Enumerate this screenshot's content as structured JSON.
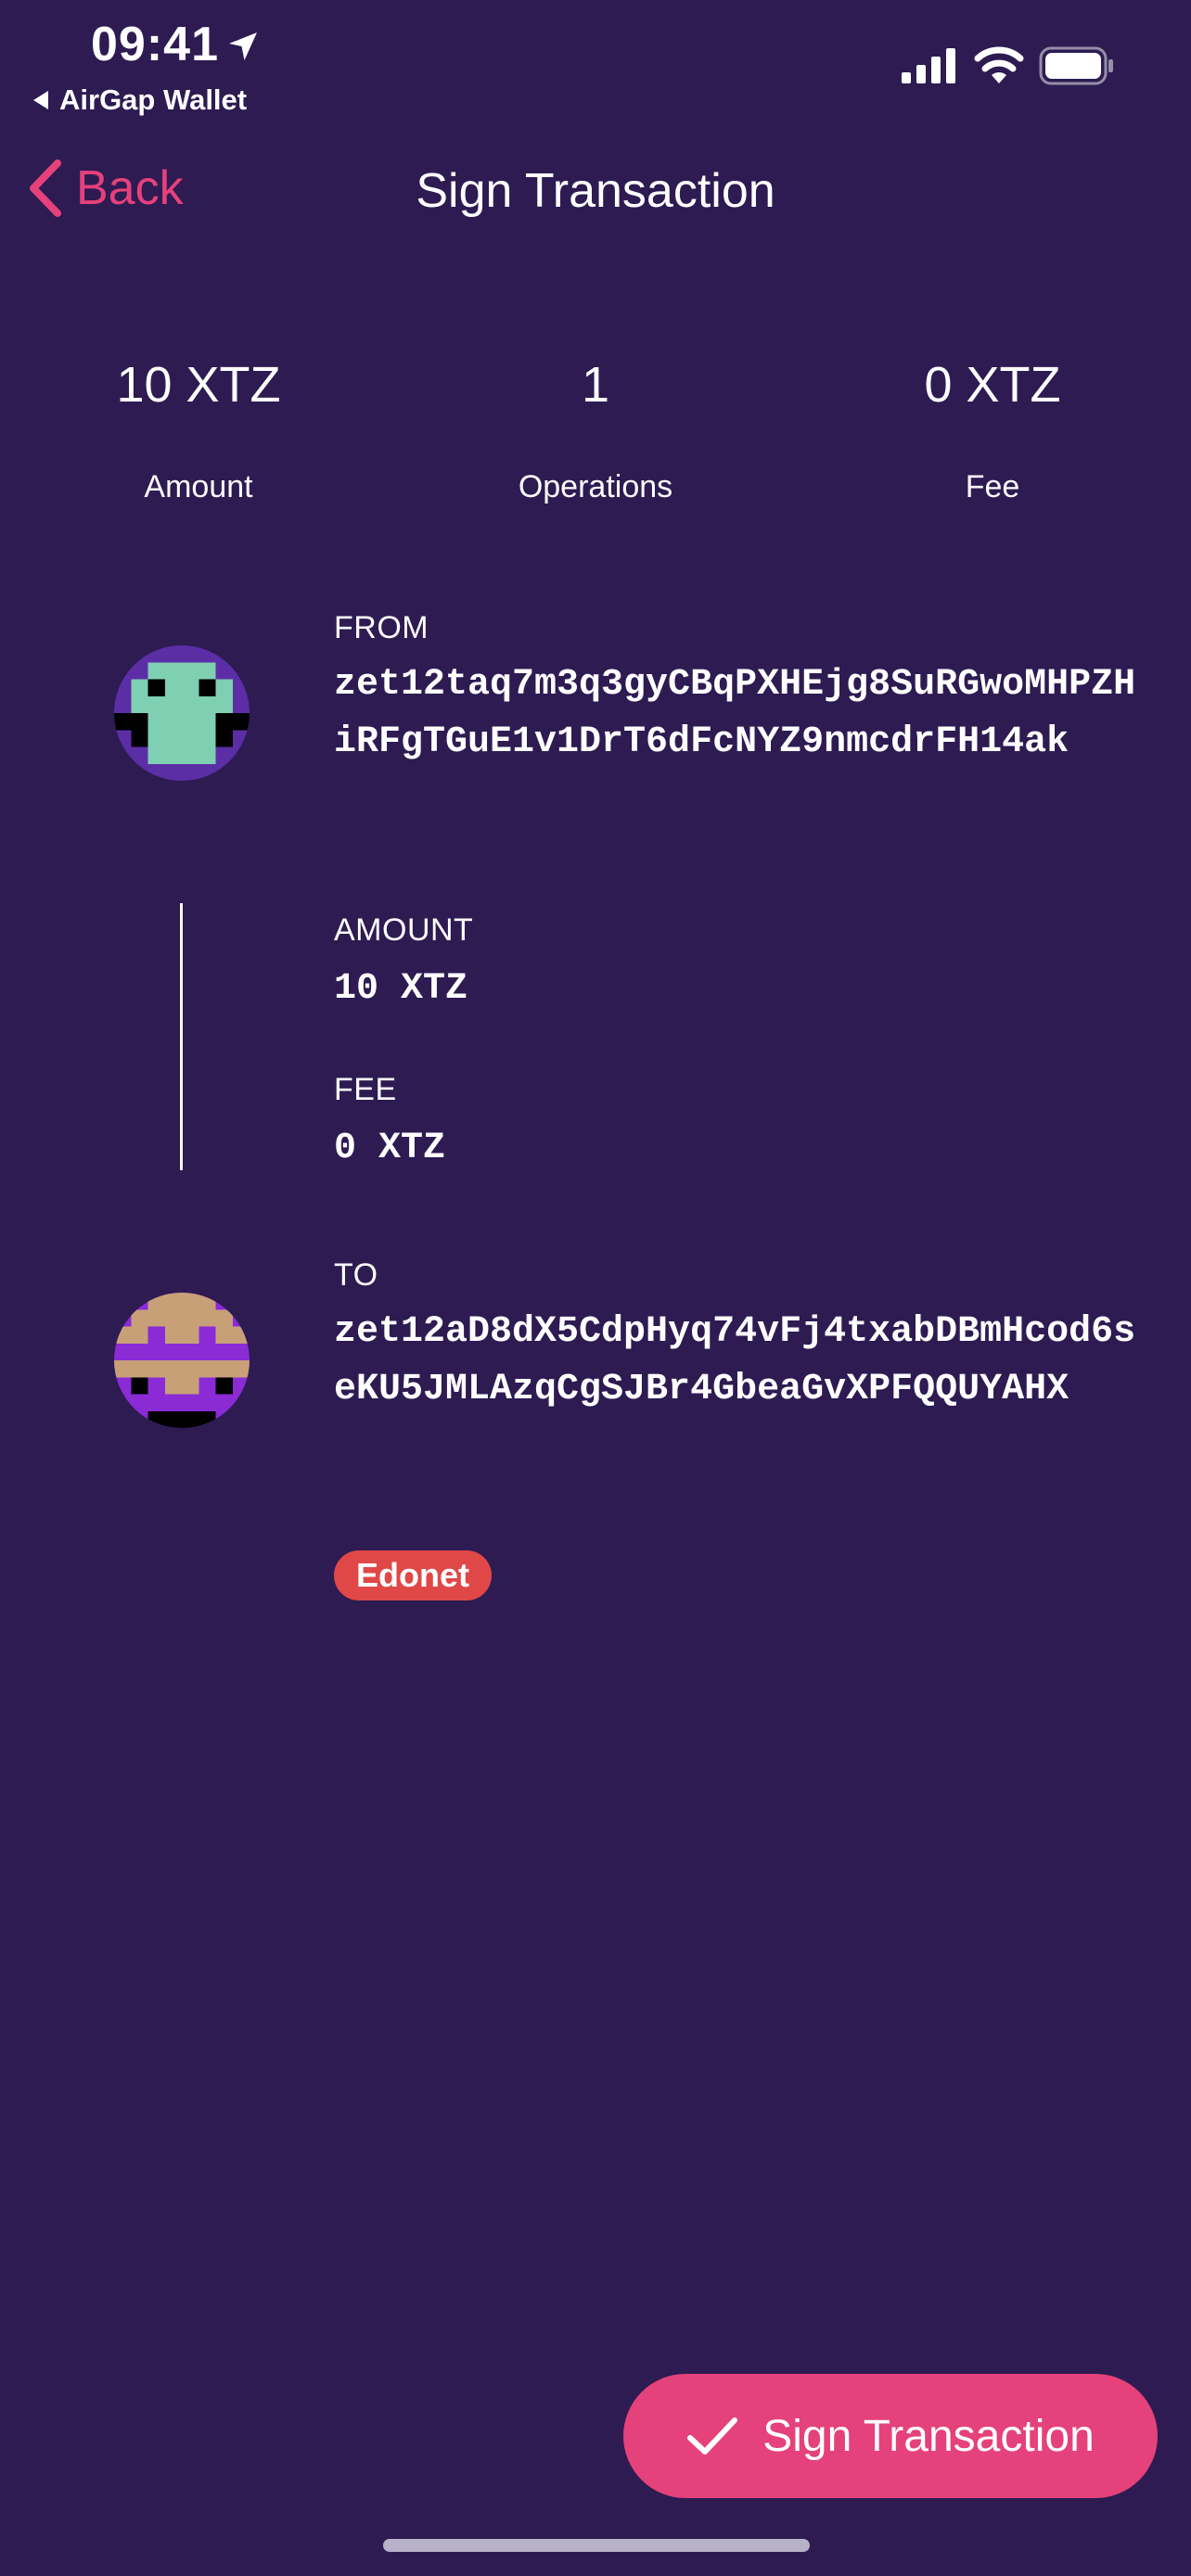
{
  "status_bar": {
    "time": "09:41",
    "back_app": "AirGap Wallet"
  },
  "nav": {
    "back_label": "Back",
    "title": "Sign Transaction"
  },
  "summary": [
    {
      "value": "10 XTZ",
      "label": "Amount"
    },
    {
      "value": "1",
      "label": "Operations"
    },
    {
      "value": "0 XTZ",
      "label": "Fee"
    }
  ],
  "transaction": {
    "from_label": "FROM",
    "from_address": "zet12taq7m3q3gyCBqPXHEjg8SuRGwoMHPZHiRFgTGuE1v1DrT6dFcNYZ9nmcdrFH14ak",
    "amount_label": "AMOUNT",
    "amount_value": "10 XTZ",
    "fee_label": "FEE",
    "fee_value": "0 XTZ",
    "to_label": "TO",
    "to_address": "zet12aD8dX5CdpHyq74vFj4txabDBmHcod6seKU5JMLAzqCgSJBr4GbeaGvXPFQQUYAHX",
    "network_badge": "Edonet"
  },
  "actions": {
    "sign_label": "Sign Transaction"
  },
  "colors": {
    "background": "#2d1b52",
    "accent": "#e5417b",
    "badge": "#e04848"
  },
  "icons": {
    "status": [
      "location-arrow-icon",
      "signal-icon",
      "wifi-icon",
      "battery-icon"
    ],
    "nav": "chevron-left-icon",
    "sign": "checkmark-icon"
  }
}
